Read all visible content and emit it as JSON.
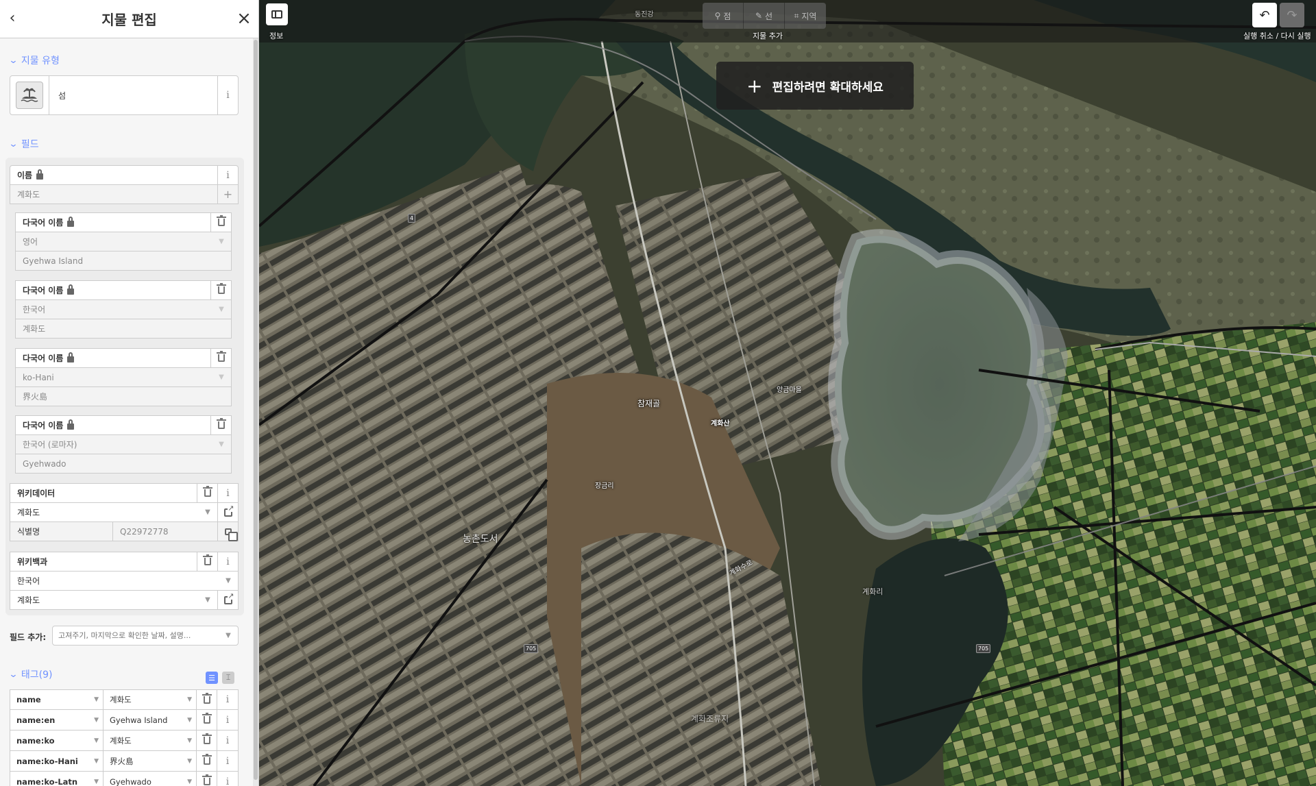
{
  "sidebar": {
    "title": "지물 편집",
    "feature_type_section": "지물 유형",
    "preset_name": "섬",
    "fields_section": "필드",
    "name_field": {
      "label": "이름",
      "value": "계화도"
    },
    "multilingual": [
      {
        "label": "다국어 이름",
        "language": "영어",
        "value": "Gyehwa Island"
      },
      {
        "label": "다국어 이름",
        "language": "한국어",
        "value": "계화도"
      },
      {
        "label": "다국어 이름",
        "language": "ko-Hani",
        "value": "界火島"
      },
      {
        "label": "다국어 이름",
        "language": "한국어 (로마자)",
        "value": "Gyehwado"
      }
    ],
    "wikidata": {
      "label": "위키데이터",
      "value": "계화도",
      "id_label": "식별명",
      "id_value": "Q22972778"
    },
    "wikipedia": {
      "label": "위키백과",
      "language": "한국어",
      "value": "계화도"
    },
    "add_field": {
      "label": "필드 추가:",
      "placeholder": "고져주기, 마지막으로 확인한 날짜, 설명..."
    },
    "tags_section": "태그(9)",
    "tags": [
      {
        "key": "name",
        "value": "계화도"
      },
      {
        "key": "name:en",
        "value": "Gyehwa Island"
      },
      {
        "key": "name:ko",
        "value": "계화도"
      },
      {
        "key": "name:ko-Hani",
        "value": "界火島"
      },
      {
        "key": "name:ko-Latn",
        "value": "Gyehwado"
      }
    ]
  },
  "toolbar": {
    "info_label": "정보",
    "add_label": "지물 추가",
    "add_point": "점",
    "add_line": "선",
    "add_area": "지역",
    "undo_redo_label": "실행 취소 / 다시 실행"
  },
  "map": {
    "zoom_notice": "편집하려면 확대하세요",
    "labels": {
      "sanjae": "참재골",
      "gyehwasan": "계화산",
      "nongchon": "농촌도서",
      "gyehwa_suro": "계화수로",
      "gyehwa_ri": "계화리",
      "reservoir": "계화조류지",
      "janggeum": "장금리",
      "yanggeum": "양금마을",
      "donghan": "동진강"
    },
    "road_numbers": [
      "4",
      "705"
    ]
  },
  "colors": {
    "accent": "#7092ff",
    "sidebar_bg": "#f6f6f6"
  }
}
